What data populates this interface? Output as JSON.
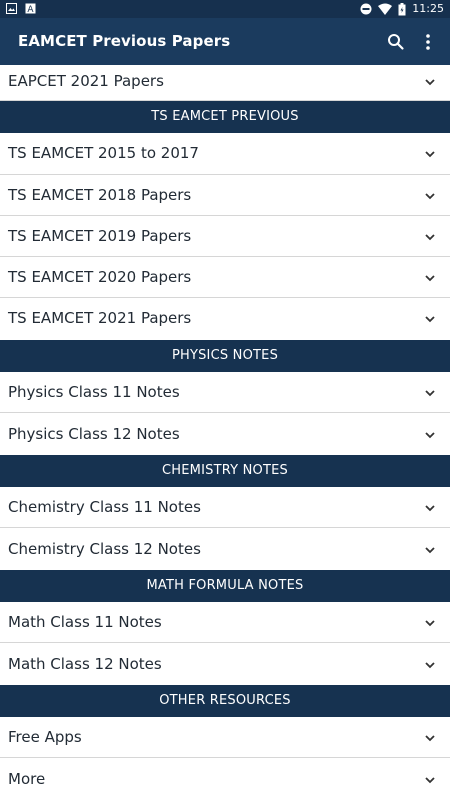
{
  "status_bar": {
    "time": "11:25",
    "icons": [
      "image-icon",
      "text-a-icon",
      "do-not-disturb-icon",
      "wifi-icon",
      "battery-icon"
    ]
  },
  "app_bar": {
    "title": "EAMCET Previous Papers",
    "icons": [
      "search-icon",
      "more-vert-icon"
    ]
  },
  "items": {
    "eapcet_2021": "EAPCET 2021 Papers",
    "ts_header": "TS EAMCET PREVIOUS",
    "ts_2015_2017": "TS EAMCET 2015 to 2017",
    "ts_2018": "TS EAMCET 2018 Papers",
    "ts_2019": "TS EAMCET 2019 Papers",
    "ts_2020": "TS EAMCET 2020 Papers",
    "ts_2021": "TS EAMCET 2021 Papers",
    "physics_header": "PHYSICS NOTES",
    "physics_11": "Physics Class 11 Notes",
    "physics_12": "Physics Class 12 Notes",
    "chemistry_header": "CHEMISTRY NOTES",
    "chemistry_11": "Chemistry Class 11 Notes",
    "chemistry_12": "Chemistry Class 12 Notes",
    "math_header": "MATH FORMULA NOTES",
    "math_11": "Math Class 11 Notes",
    "math_12": "Math Class 12 Notes",
    "other_header": "OTHER RESOURCES",
    "free_apps": "Free Apps",
    "more": "More"
  },
  "colors": {
    "app_bar": "#1b3b5e",
    "status_bar": "#16304e",
    "section_header": "#163250",
    "divider": "#d6d6d6"
  }
}
